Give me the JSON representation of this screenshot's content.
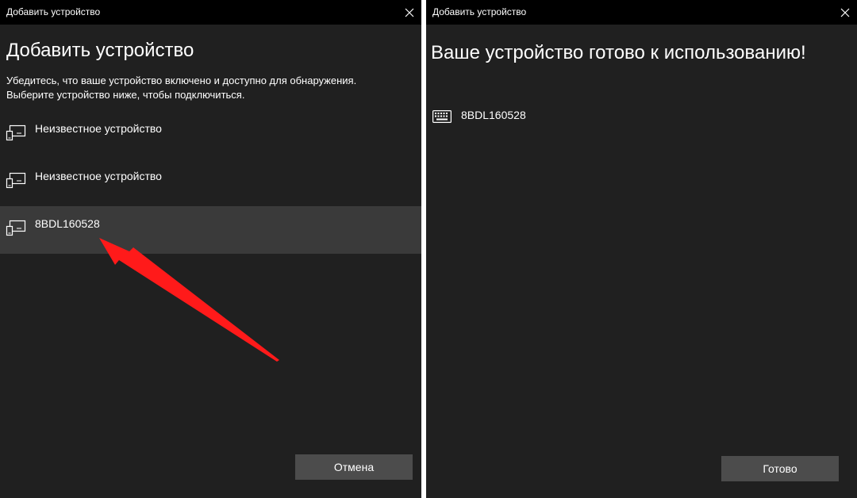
{
  "left_window": {
    "title": "Добавить устройство",
    "heading": "Добавить устройство",
    "instructions": [
      "Убедитесь, что ваше устройство включено и доступно для обнаружения.",
      "Выберите устройство ниже, чтобы подключиться."
    ],
    "devices": [
      {
        "label": "Неизвестное устройство",
        "icon": "display-device-icon",
        "selected": false
      },
      {
        "label": "Неизвестное устройство",
        "icon": "display-device-icon",
        "selected": false
      },
      {
        "label": "8BDL160528",
        "icon": "display-device-icon",
        "selected": true
      }
    ],
    "cancel_label": "Отмена"
  },
  "right_window": {
    "title": "Добавить устройство",
    "heading": "Ваше устройство готово к использованию!",
    "device": {
      "label": "8BDL160528",
      "icon": "keyboard-icon"
    },
    "done_label": "Готово"
  },
  "annotation": {
    "icon": "red-arrow-pointer",
    "color": "#ff1a1a"
  },
  "colors": {
    "window_bg": "#202020",
    "titlebar_bg": "#000000",
    "selected_row": "#3a3a3a",
    "button_bg": "#4c4c4c"
  }
}
